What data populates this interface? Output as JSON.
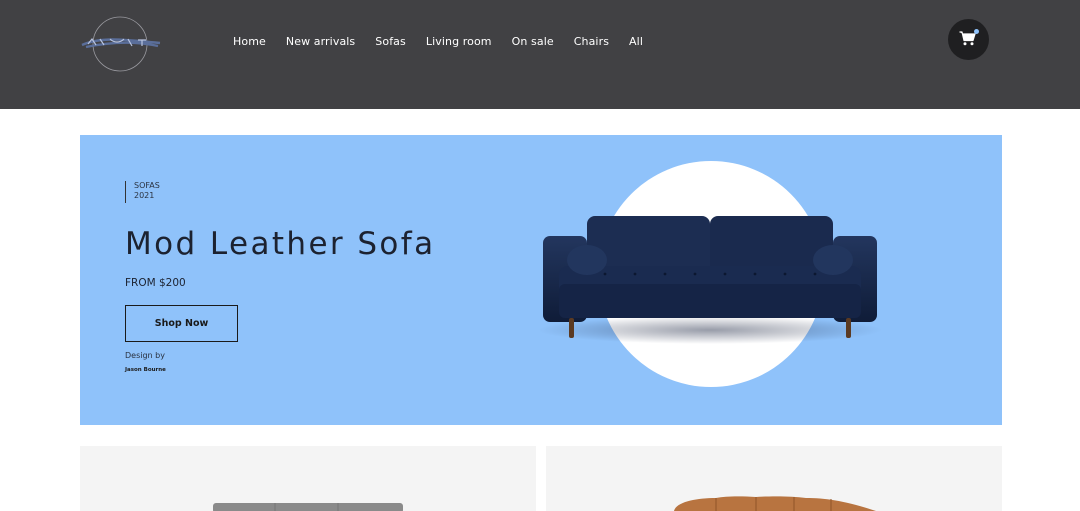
{
  "header": {
    "logo_icon": "brand-logo",
    "nav": [
      {
        "label": "Home"
      },
      {
        "label": "New arrivals"
      },
      {
        "label": "Sofas"
      },
      {
        "label": "Living room"
      },
      {
        "label": "On sale"
      },
      {
        "label": "Chairs"
      },
      {
        "label": "All"
      }
    ],
    "cart_icon": "cart-icon"
  },
  "hero": {
    "category": "SOFAS",
    "year": "2021",
    "title": "Mod Leather Sofa",
    "price": "FROM $200",
    "cta_label": "Shop Now",
    "design_by_label": "Design by",
    "designer": "Jason Bourne",
    "background_color": "#8fc2fa"
  },
  "products": [
    {
      "image": "grey-sofa"
    },
    {
      "image": "tan-leather-sofa"
    }
  ]
}
